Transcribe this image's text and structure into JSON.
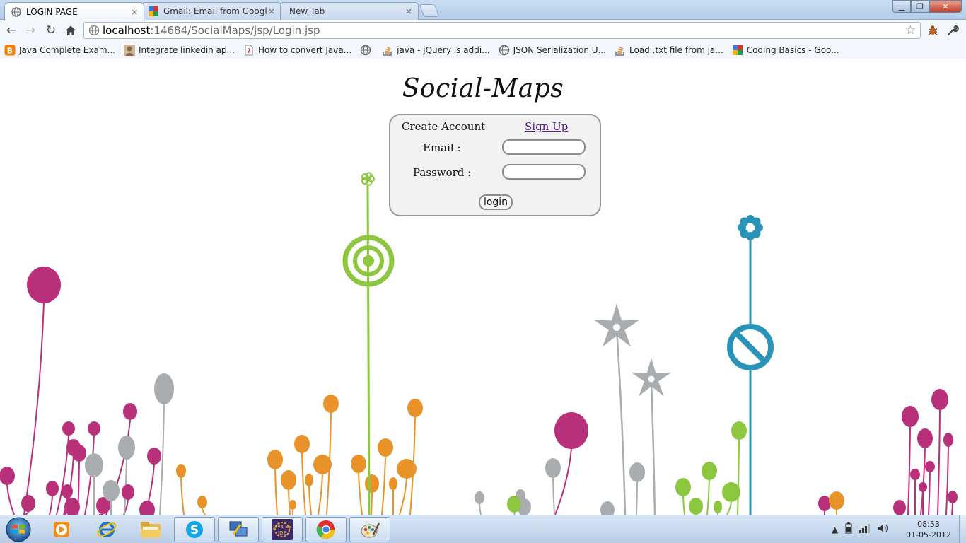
{
  "browser": {
    "tabs": [
      {
        "label": "LOGIN PAGE",
        "icon": "globe-icon",
        "active": true
      },
      {
        "label": "Gmail: Email from Google",
        "icon": "google-icon",
        "active": false
      },
      {
        "label": "New Tab",
        "icon": "",
        "active": false
      }
    ],
    "close_glyph": "×",
    "address": {
      "host": "localhost",
      "rest": ":14684/SocialMaps/jsp/Login.jsp"
    },
    "bookmarks": [
      {
        "label": "Java Complete Exam...",
        "icon": "blogger-icon",
        "color": "#f57d00"
      },
      {
        "label": "Integrate linkedin ap...",
        "icon": "user-avatar-icon",
        "color": "#8a6a4a"
      },
      {
        "label": "How to convert Java...",
        "icon": "question-page-icon",
        "color": "#c03030"
      },
      {
        "label": "",
        "icon": "globe-icon",
        "color": "#666666"
      },
      {
        "label": "java - jQuery is addi...",
        "icon": "stackoverflow-icon",
        "color": "#e5882b"
      },
      {
        "label": "JSON Serialization U...",
        "icon": "globe-icon",
        "color": "#666666"
      },
      {
        "label": "Load .txt file from ja...",
        "icon": "stackoverflow-icon",
        "color": "#e5882b"
      },
      {
        "label": "Coding Basics - Goo...",
        "icon": "google-icon",
        "color": "#3a7ae0"
      }
    ]
  },
  "page": {
    "title": "Social-Maps",
    "login": {
      "create_account": "Create Account",
      "sign_up": "Sign Up",
      "email_label": "Email :",
      "password_label": "Password :",
      "email_value": "",
      "password_value": "",
      "login_button": "login"
    },
    "colors": {
      "magenta": "#b8307a",
      "orange": "#e8922a",
      "green": "#8dc63f",
      "gray": "#a9adb0",
      "blue": "#2a94b8"
    }
  },
  "taskbar": {
    "items": [
      {
        "name": "media-player-icon"
      },
      {
        "name": "internet-explorer-icon"
      },
      {
        "name": "file-explorer-icon"
      },
      {
        "name": "skype-icon"
      },
      {
        "name": "remote-desktop-icon"
      },
      {
        "name": "java-ee-ide-icon",
        "label": "Java EE IDE"
      },
      {
        "name": "chrome-icon"
      },
      {
        "name": "paint-icon"
      }
    ],
    "clock": {
      "time": "08:53",
      "date": "01-05-2012"
    }
  }
}
